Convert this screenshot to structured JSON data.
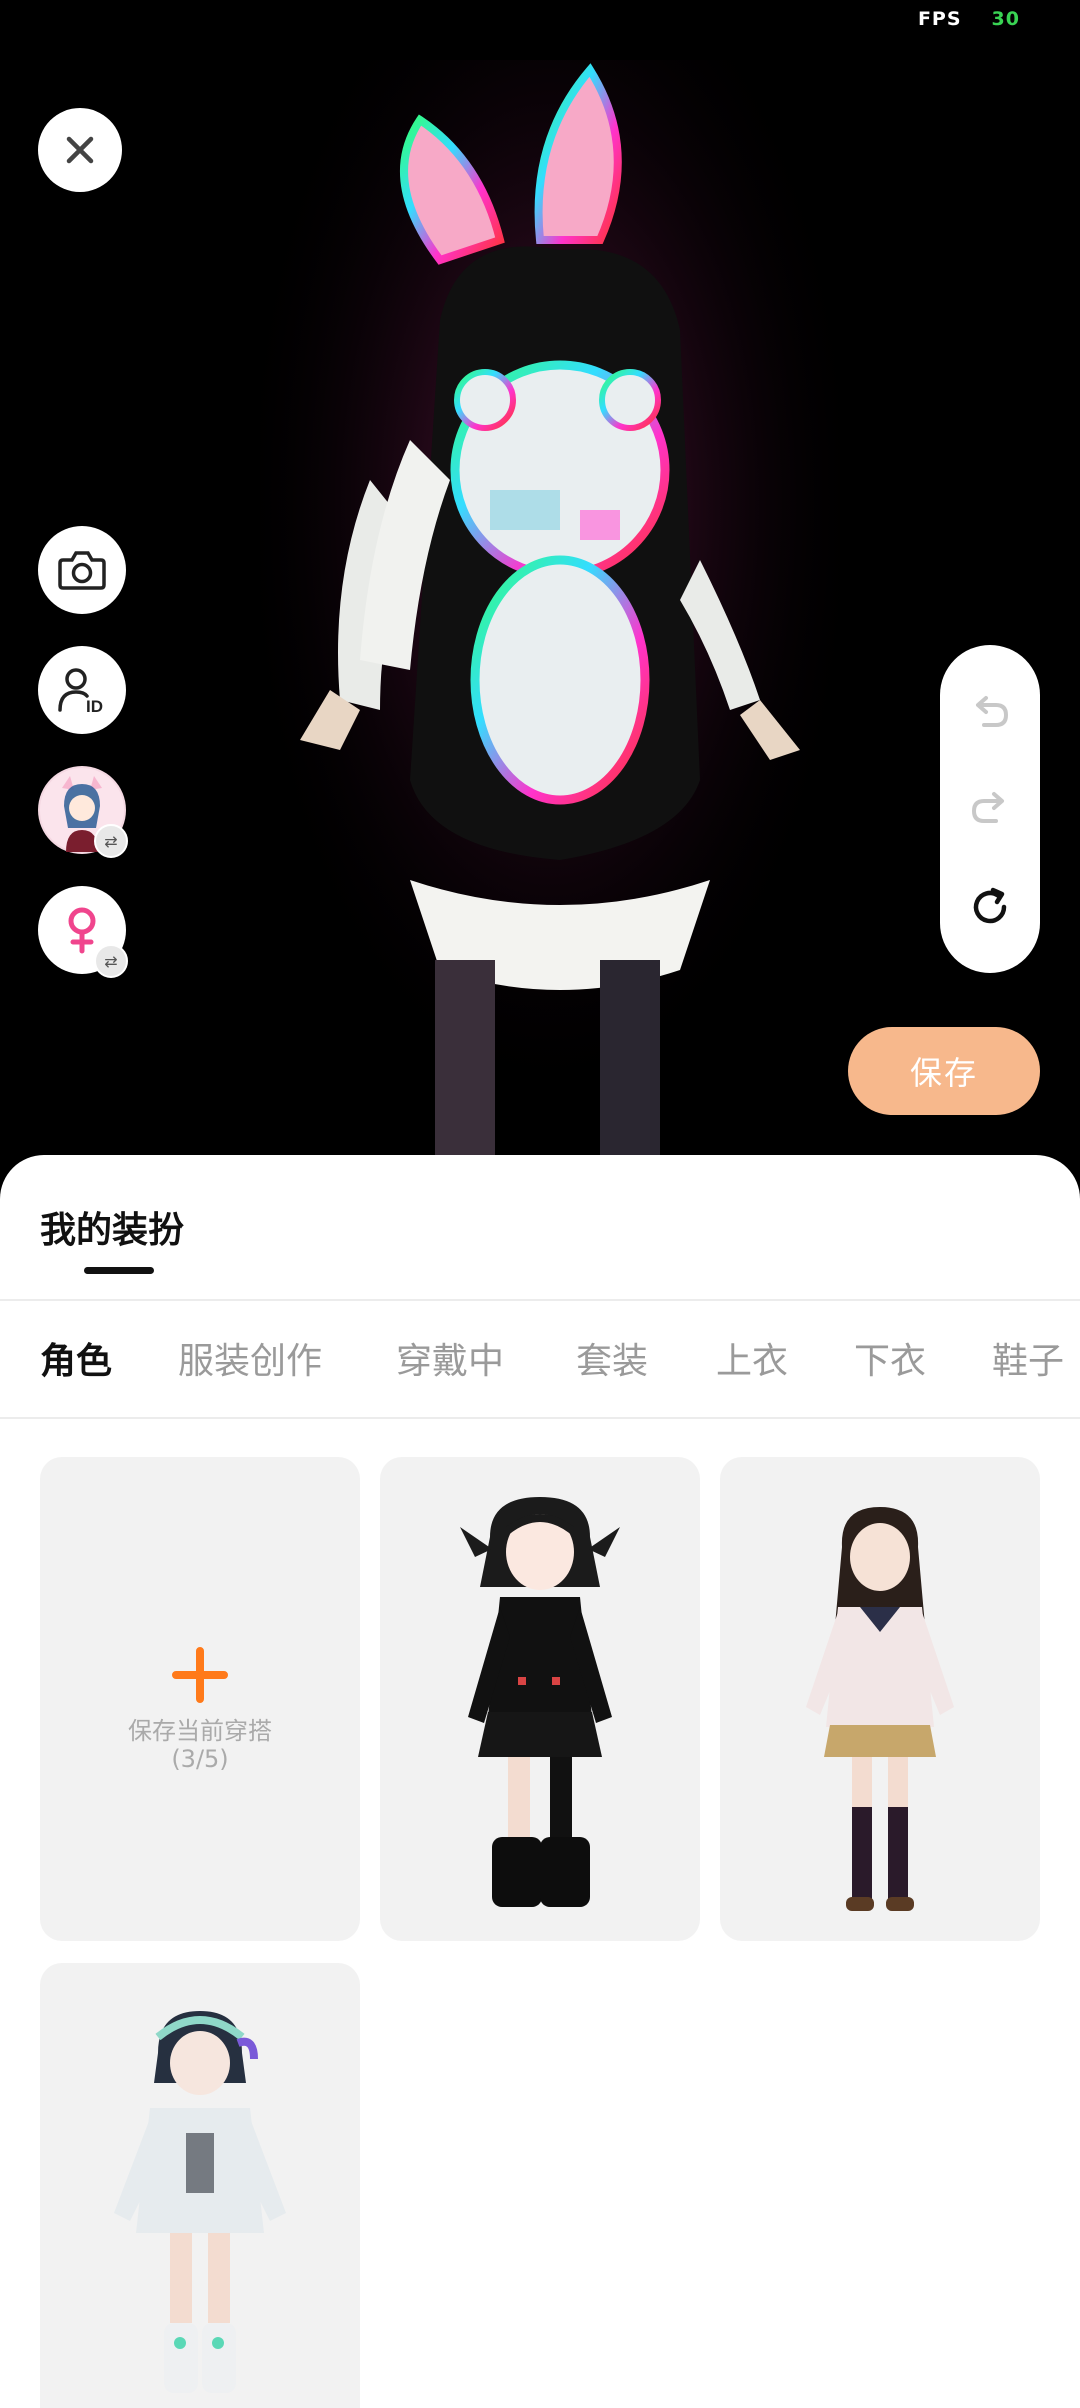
{
  "status": {
    "fps_label": "FPS",
    "fps_value": "30"
  },
  "viewport": {
    "close_icon": "close-icon",
    "side_buttons": [
      "camera-icon",
      "profile-id-icon",
      "avatar-swap-thumbnail",
      "female-gender-icon"
    ],
    "history": [
      "undo-icon",
      "redo-icon",
      "reset-icon"
    ],
    "save_label": "保存"
  },
  "sheet": {
    "title": "我的装扮",
    "tabs": [
      "角色",
      "服装创作",
      "穿戴中",
      "套装",
      "上衣",
      "下衣",
      "鞋子"
    ],
    "active_tab": "角色",
    "add_card": {
      "label": "保存当前穿搭",
      "count": "(3/5)"
    }
  },
  "colors": {
    "accent_orange": "#f7b88c",
    "plus_orange": "#ff7a1a",
    "fps_green": "#39d353"
  }
}
